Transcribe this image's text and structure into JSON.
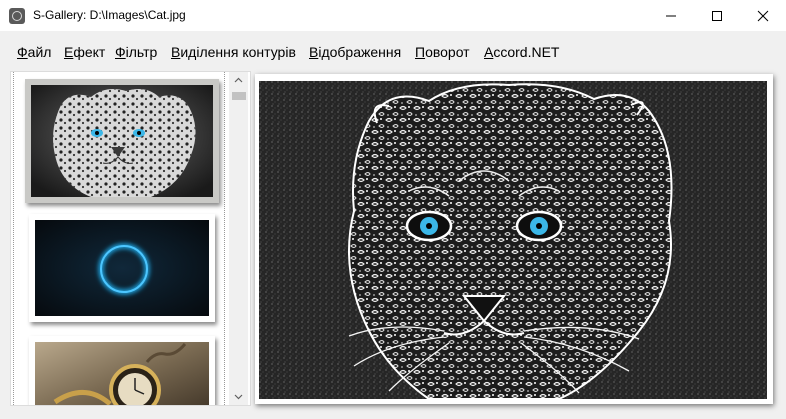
{
  "window": {
    "title": "S-Gallery: D:\\Images\\Cat.jpg",
    "icon": "app-logo-icon",
    "controls": [
      "minimize-icon",
      "maximize-icon",
      "close-icon"
    ]
  },
  "menu": {
    "items": [
      {
        "accel": "Ф",
        "rest": "айл"
      },
      {
        "accel": "Е",
        "rest": "фект"
      },
      {
        "accel": "Ф",
        "rest": "ільтр"
      },
      {
        "accel": "В",
        "rest": "иділення контурів"
      },
      {
        "accel": "В",
        "rest": "ідображення"
      },
      {
        "accel": "П",
        "rest": "оворот"
      },
      {
        "accel": "A",
        "rest": "ccord.NET"
      }
    ]
  },
  "thumbnails": [
    {
      "subject": "snow leopard",
      "selected": true
    },
    {
      "subject": "glowing blue ring",
      "selected": false
    },
    {
      "subject": "pocket watch",
      "selected": false
    }
  ],
  "main_image": {
    "subject": "snow leopard edge-detected",
    "effect": "contour"
  },
  "colors": {
    "ring": "#1fa8e6",
    "eyes": "#3bb7e8",
    "selection": "#c9c9c6"
  }
}
